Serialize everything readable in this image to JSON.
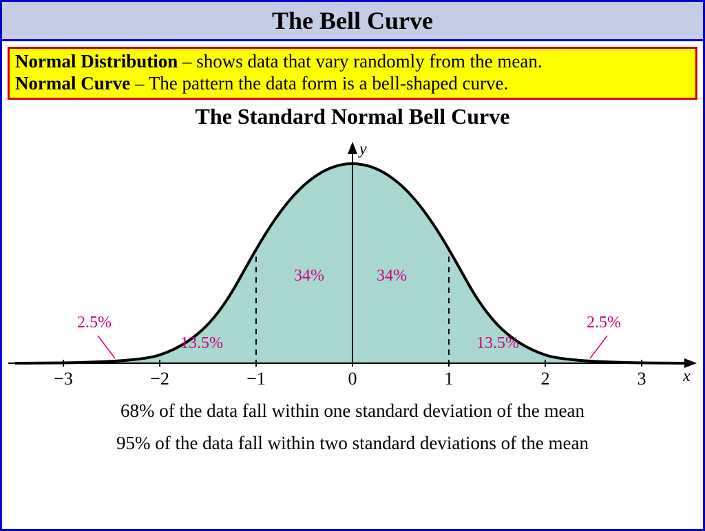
{
  "title": "The Bell Curve",
  "definitions": {
    "term1": "Normal Distribution",
    "sep1": " – ",
    "desc1": "shows data that vary randomly from the mean.",
    "term2": "Normal Curve",
    "sep2": " – ",
    "desc2": "The pattern the data form is a bell-shaped curve."
  },
  "subtitle": "The Standard Normal Bell Curve",
  "chart_data": {
    "type": "area",
    "title": "The Standard Normal Bell Curve",
    "xlabel": "x",
    "ylabel": "y",
    "x_ticks": [
      "−3",
      "−2",
      "−1",
      "0",
      "1",
      "2",
      "3"
    ],
    "x_range": [
      -3.5,
      3.5
    ],
    "regions": [
      {
        "from": -3,
        "to": -2,
        "percent": "2.5%"
      },
      {
        "from": -2,
        "to": -1,
        "percent": "13.5%"
      },
      {
        "from": -1,
        "to": 0,
        "percent": "34%"
      },
      {
        "from": 0,
        "to": 1,
        "percent": "34%"
      },
      {
        "from": 1,
        "to": 2,
        "percent": "13.5%"
      },
      {
        "from": 2,
        "to": 3,
        "percent": "2.5%"
      }
    ],
    "axes": {
      "y_axis_label": "y",
      "x_axis_label": "x"
    }
  },
  "captions": {
    "line1": "68% of the data fall within one standard deviation of the mean",
    "line2": "95% of the data fall within two standard deviations of the mean"
  }
}
